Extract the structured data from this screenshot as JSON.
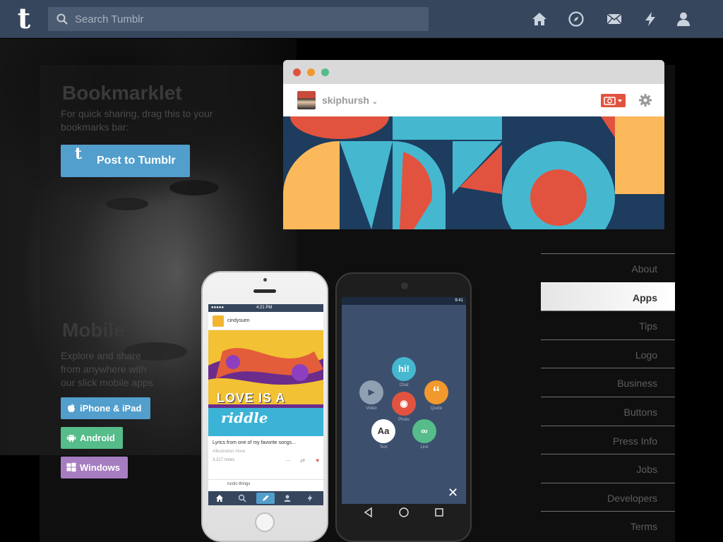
{
  "header": {
    "logo": "t",
    "search_placeholder": "Search Tumblr",
    "icons": [
      "home-icon",
      "explore-icon",
      "inbox-icon",
      "activity-icon",
      "account-icon"
    ]
  },
  "bookmarklet": {
    "title": "Bookmarklet",
    "description_line1": "For quick sharing, drag this to your",
    "description_line2": "bookmarks bar:",
    "button_label": "Post to Tumblr",
    "button_icon": "t"
  },
  "mobile": {
    "title": "Mobile",
    "description_line1": "Explore and share",
    "description_line2": "from anywhere with",
    "description_line3": "our slick mobile apps",
    "buttons": [
      {
        "label": "iPhone & iPad",
        "icon": "apple-icon",
        "color": "#529ecc"
      },
      {
        "label": "Android",
        "icon": "android-icon",
        "color": "#56bc8a"
      },
      {
        "label": "Windows",
        "icon": "windows-icon",
        "color": "#a77dc2"
      }
    ]
  },
  "browser_mock": {
    "blog_name": "skiphursh",
    "colors": {
      "red": "#e2533f",
      "teal": "#45b8d0",
      "yellow": "#fbb95b",
      "navy": "#1d3c5e"
    }
  },
  "iphone_mock": {
    "time": "4:21 PM",
    "carrier": "●●●●● ",
    "post_author": "cindysuen",
    "art_line1": "LOVE IS A",
    "art_line2": "riddle",
    "caption": "Lyrics from one of my favorite songs...",
    "tags": "#illustration  #love",
    "notes": "3,217 notes",
    "next_author": "rustic-things"
  },
  "android_mock": {
    "time": "9:41",
    "options": [
      {
        "label": "Chat",
        "glyph": "hi!",
        "color": "#45b8d0"
      },
      {
        "label": "Quote",
        "glyph": "“",
        "color": "#f2992e"
      },
      {
        "label": "Video",
        "glyph": "▶",
        "color": "#8fa0b3"
      },
      {
        "label": "Photo",
        "glyph": "◉",
        "color": "#e2533f"
      },
      {
        "label": "Text",
        "glyph": "Aa",
        "color": "#ffffff"
      },
      {
        "label": "Link",
        "glyph": "∞",
        "color": "#56bc8a"
      }
    ],
    "close_glyph": "✕"
  },
  "side_nav": {
    "items": [
      {
        "label": "About",
        "active": false
      },
      {
        "label": "Apps",
        "active": true
      },
      {
        "label": "Tips",
        "active": false
      },
      {
        "label": "Logo",
        "active": false
      },
      {
        "label": "Business",
        "active": false
      },
      {
        "label": "Buttons",
        "active": false
      },
      {
        "label": "Press Info",
        "active": false
      },
      {
        "label": "Jobs",
        "active": false
      },
      {
        "label": "Developers",
        "active": false
      },
      {
        "label": "Terms",
        "active": false
      }
    ]
  }
}
